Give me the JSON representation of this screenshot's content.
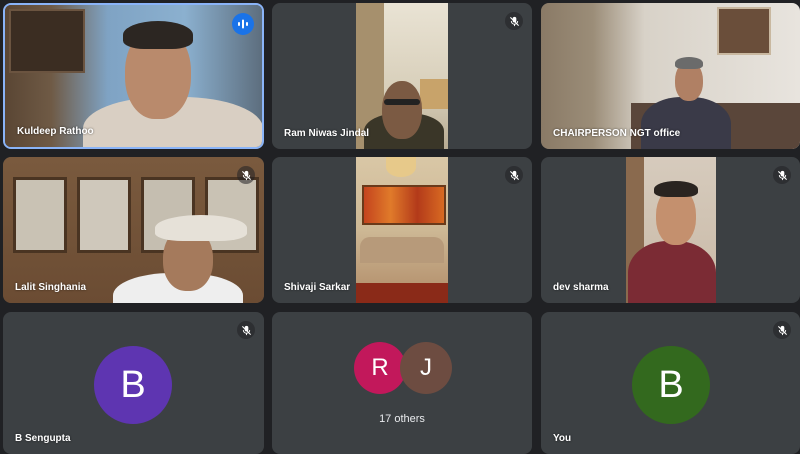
{
  "participants": [
    {
      "name": "Kuldeep Rathoo",
      "state": "speaking",
      "speaking_icon": "audio-wave-icon"
    },
    {
      "name": "Ram Niwas Jindal",
      "state": "muted",
      "mic_icon": "mic-off-icon"
    },
    {
      "name": "CHAIRPERSON NGT office",
      "state": "video"
    },
    {
      "name": "Lalit Singhania",
      "state": "muted",
      "mic_icon": "mic-off-icon"
    },
    {
      "name": "Shivaji Sarkar",
      "state": "muted",
      "mic_icon": "mic-off-icon"
    },
    {
      "name": "dev sharma",
      "state": "muted",
      "mic_icon": "mic-off-icon"
    },
    {
      "name": "B Sengupta",
      "state": "muted",
      "avatar_letter": "B",
      "avatar_color": "#5e35b1",
      "mic_icon": "mic-off-icon"
    },
    {
      "name": "You",
      "state": "muted",
      "avatar_letter": "B",
      "avatar_color": "#33691e",
      "mic_icon": "mic-off-icon"
    }
  ],
  "others_tile": {
    "avatars": [
      {
        "letter": "R",
        "color": "#c2185b"
      },
      {
        "letter": "J",
        "color": "#6d4c41"
      }
    ],
    "label": "17 others"
  },
  "colors": {
    "background": "#202124",
    "tile": "#3c4043",
    "active_border": "#8ab4f8",
    "speaking": "#1a73e8"
  }
}
